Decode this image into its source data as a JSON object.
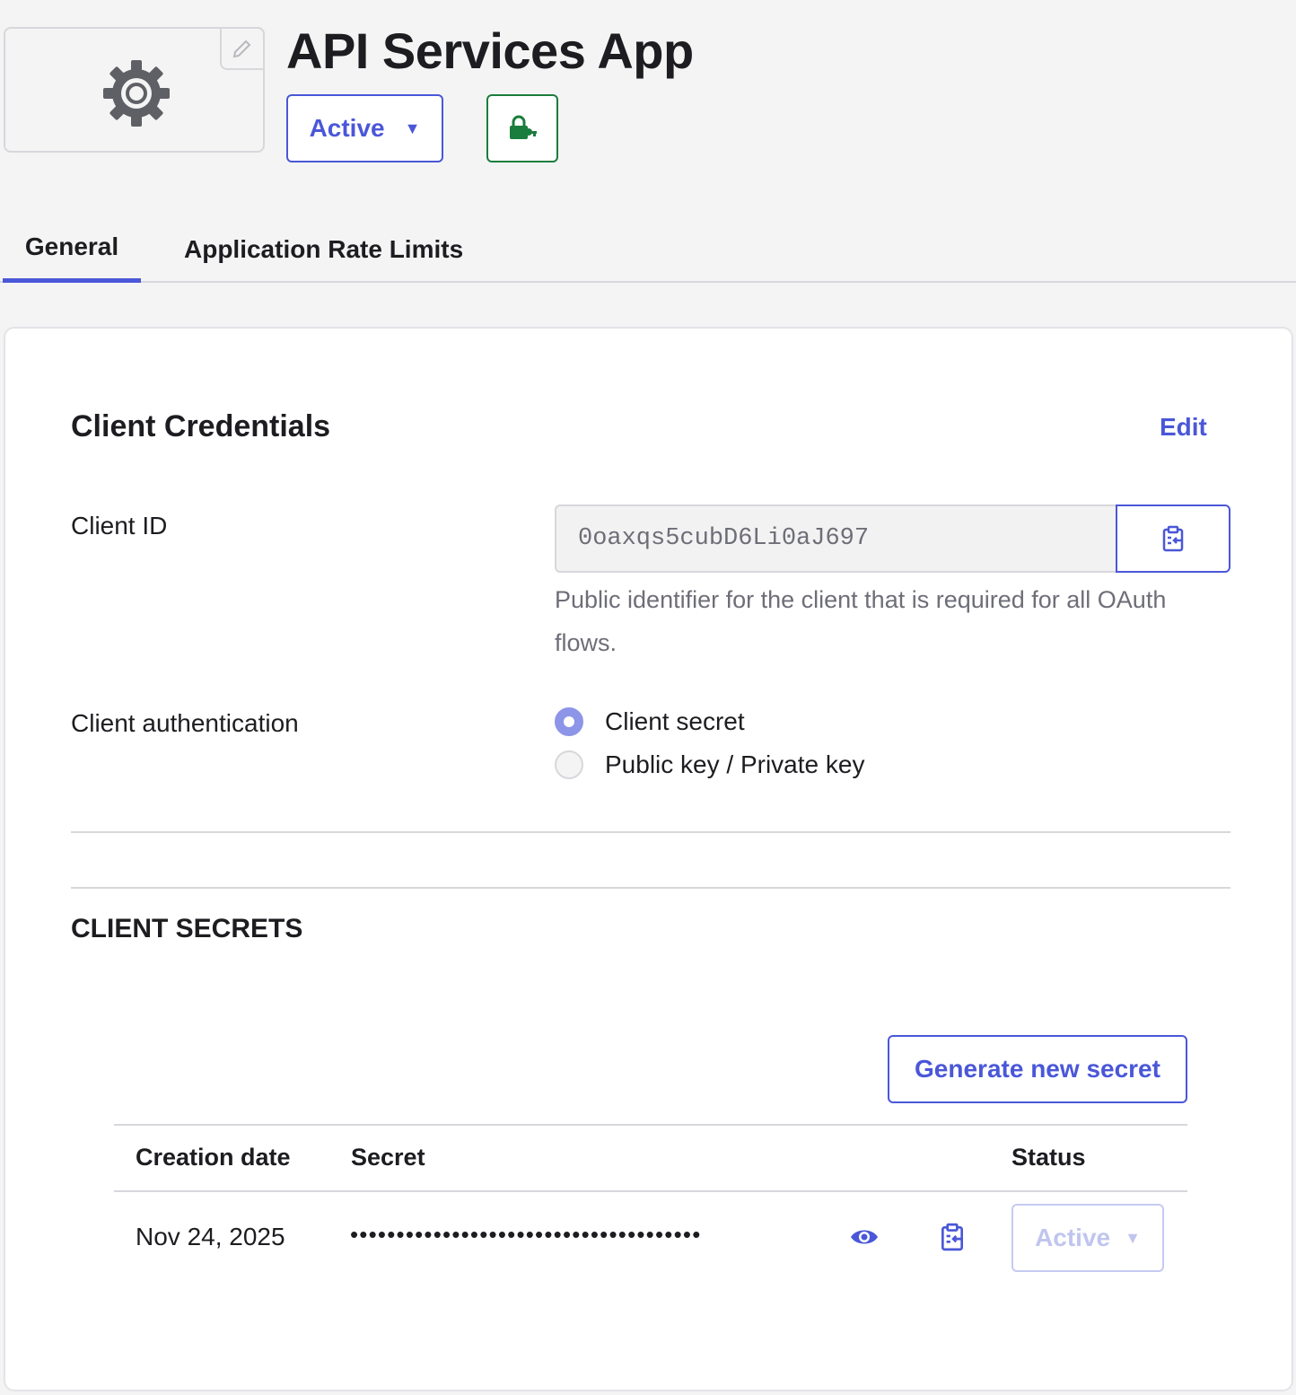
{
  "header": {
    "app_title": "API Services App",
    "status_label": "Active",
    "status_caret": "▼",
    "logo_icon": "gear-icon",
    "edit_logo_icon": "pencil-icon",
    "lock_icon": "lock-key-icon",
    "accent_color": "#4a57d8",
    "lock_color": "#1a7d3d"
  },
  "tabs": [
    {
      "label": "General",
      "active": true
    },
    {
      "label": "Application Rate Limits",
      "active": false
    }
  ],
  "card": {
    "title": "Client Credentials",
    "edit_label": "Edit",
    "client_id": {
      "label": "Client ID",
      "value": "0oaxqs5cubD6Li0aJ697",
      "help": "Public identifier for the client that is required for all OAuth flows.",
      "copy_icon": "clipboard-copy-icon"
    },
    "client_auth": {
      "label": "Client authentication",
      "options": [
        {
          "label": "Client secret",
          "checked": true
        },
        {
          "label": "Public key / Private key",
          "checked": false
        }
      ]
    },
    "secrets": {
      "heading": "CLIENT SECRETS",
      "generate_label": "Generate new secret",
      "columns": [
        "Creation date",
        "Secret",
        "Status"
      ],
      "rows": [
        {
          "date": "Nov 24, 2025",
          "secret_masked": "••••••••••••••••••••••••••••••••••••••",
          "reveal_icon": "eye-icon",
          "copy_icon": "clipboard-copy-icon",
          "status": "Active",
          "status_caret": "▼"
        }
      ]
    }
  }
}
